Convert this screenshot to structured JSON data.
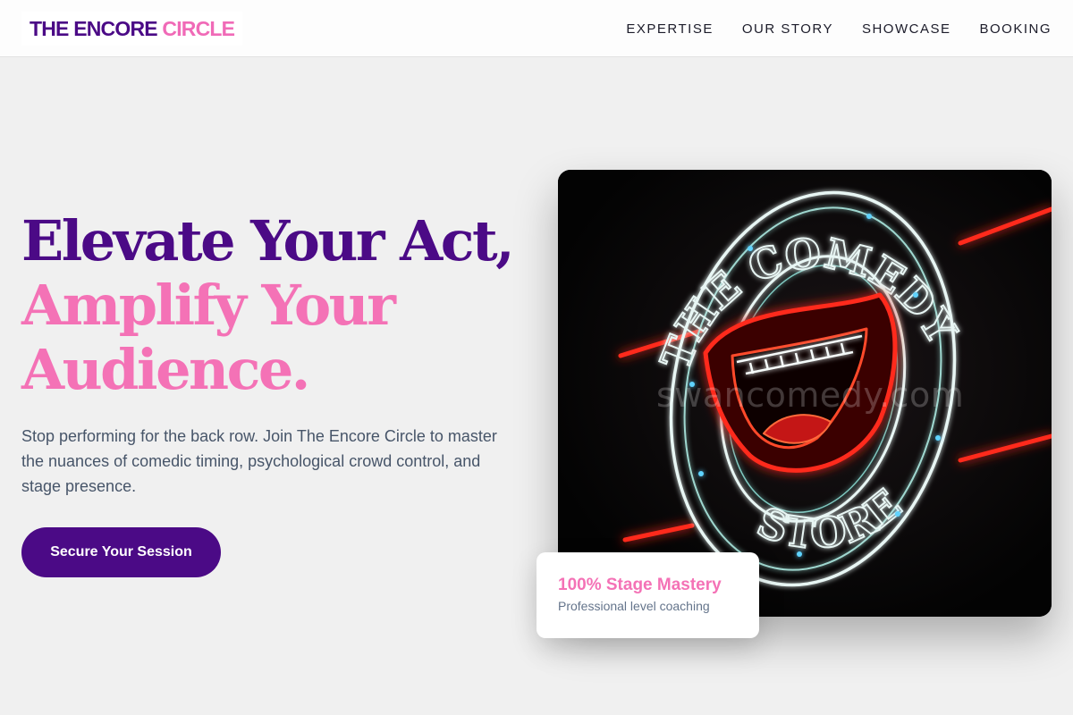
{
  "header": {
    "logo_part1": "THE ENCORE ",
    "logo_part2": "CIRCLE",
    "nav": [
      "EXPERTISE",
      "OUR STORY",
      "SHOWCASE",
      "BOOKING"
    ]
  },
  "hero": {
    "headline_line1": "Elevate Your Act,",
    "headline_line2": "Amplify Your",
    "headline_line3": "Audience.",
    "subtext": "Stop performing for the back row. Join The Encore Circle to master the nuances of comedic timing, psychological crowd control, and stage presence.",
    "cta_label": "Secure Your Session"
  },
  "image": {
    "sign_top_text": "THE COMEDY",
    "sign_bottom_text": "STORE",
    "watermark": "swancomedy.com"
  },
  "stat_card": {
    "title": "100% Stage Mastery",
    "subtitle": "Professional level coaching"
  },
  "colors": {
    "brand_purple": "#4b0a86",
    "brand_pink": "#f472b6",
    "background": "#f0f0f0"
  }
}
